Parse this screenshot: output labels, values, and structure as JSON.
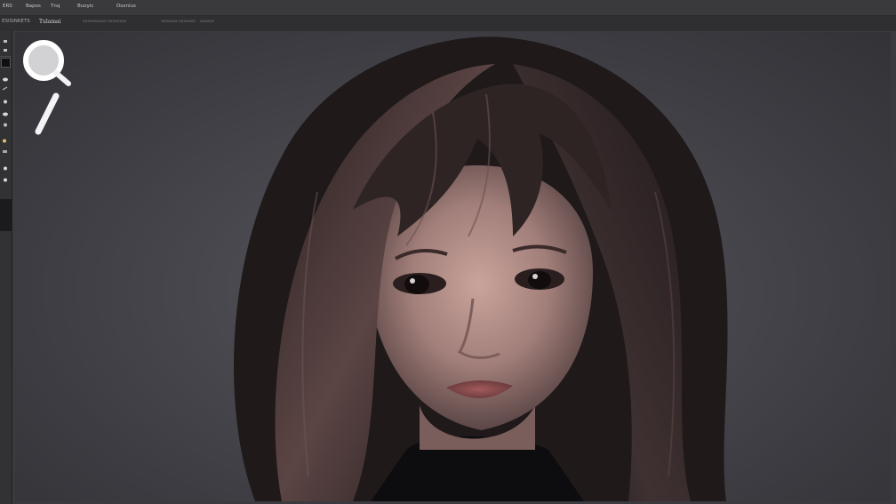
{
  "menu": {
    "items": [
      "ERS",
      "Bapos",
      "Tnq",
      "Buoyic",
      "Dosnlus"
    ]
  },
  "options": {
    "left_label": "ESISINKETS",
    "mode_label": "Tulamai",
    "field_a": "xxxxxxxxxx xxxxxxxx",
    "field_b": "xxxxxxx xxxxxxx",
    "field_c": "xxxxxx"
  },
  "toolbar": {
    "tools": [
      "move-tool-icon",
      "marquee-tool-icon",
      "lasso-tool-icon",
      "brush-tool-icon",
      "stamp-tool-icon",
      "eraser-tool-icon",
      "dodge-tool-icon",
      "pen-tool-icon",
      "type-tool-icon",
      "zoom-tool-icon"
    ]
  },
  "cursor": {
    "icon": "magnifier-cursor-icon"
  },
  "colors": {
    "menubar": "#3a3a3d",
    "optionsbar": "#2f2f31",
    "canvas_bg": "#45444a",
    "foreground_swatch": "#0f0f10"
  }
}
